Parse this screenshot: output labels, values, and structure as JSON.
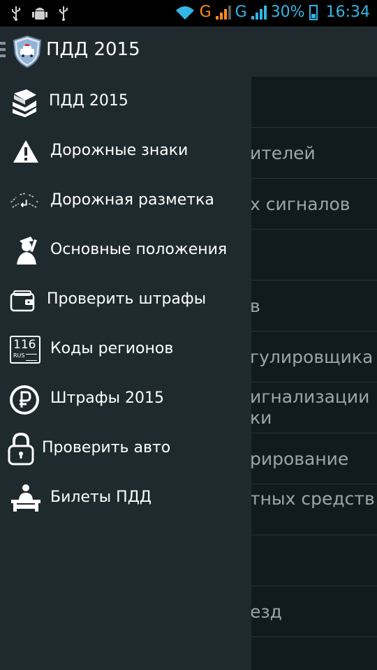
{
  "statusbar": {
    "network_1": "G",
    "network_2": "G",
    "battery": "30%",
    "time": "16:34"
  },
  "actionbar": {
    "title": "ПДД 2015"
  },
  "content_rows": [
    {
      "text": ""
    },
    {
      "text": "ителей"
    },
    {
      "text": "х сигналов"
    },
    {
      "text": ""
    },
    {
      "text": "в"
    },
    {
      "text": "гулировщика"
    },
    {
      "text": "игнализации\nки"
    },
    {
      "text": "рирование"
    },
    {
      "text": "тных средств"
    },
    {
      "text": ""
    },
    {
      "text": "езд"
    }
  ],
  "drawer": {
    "items": [
      {
        "label": "ПДД 2015",
        "icon": "books-icon"
      },
      {
        "label": "Дорожные знаки",
        "icon": "warning-sign-icon"
      },
      {
        "label": "Дорожная разметка",
        "icon": "road-marking-icon"
      },
      {
        "label": "Основные положения",
        "icon": "officer-icon"
      },
      {
        "label": "Проверить штрафы",
        "icon": "wallet-icon"
      },
      {
        "label": "Коды регионов",
        "icon": "license-plate-icon"
      },
      {
        "label": "Штрафы 2015",
        "icon": "ruble-icon"
      },
      {
        "label": "Проверить авто",
        "icon": "lock-icon"
      },
      {
        "label": "Билеты ПДД",
        "icon": "exam-desk-icon"
      }
    ],
    "plate_number": "116",
    "plate_region": "RUS"
  },
  "colors": {
    "drawer_bg": "#1f2a2e",
    "actionbar_bg": "#202a2e",
    "status_accent": "#33b5e5",
    "signal_orange": "#ff8a1c"
  }
}
